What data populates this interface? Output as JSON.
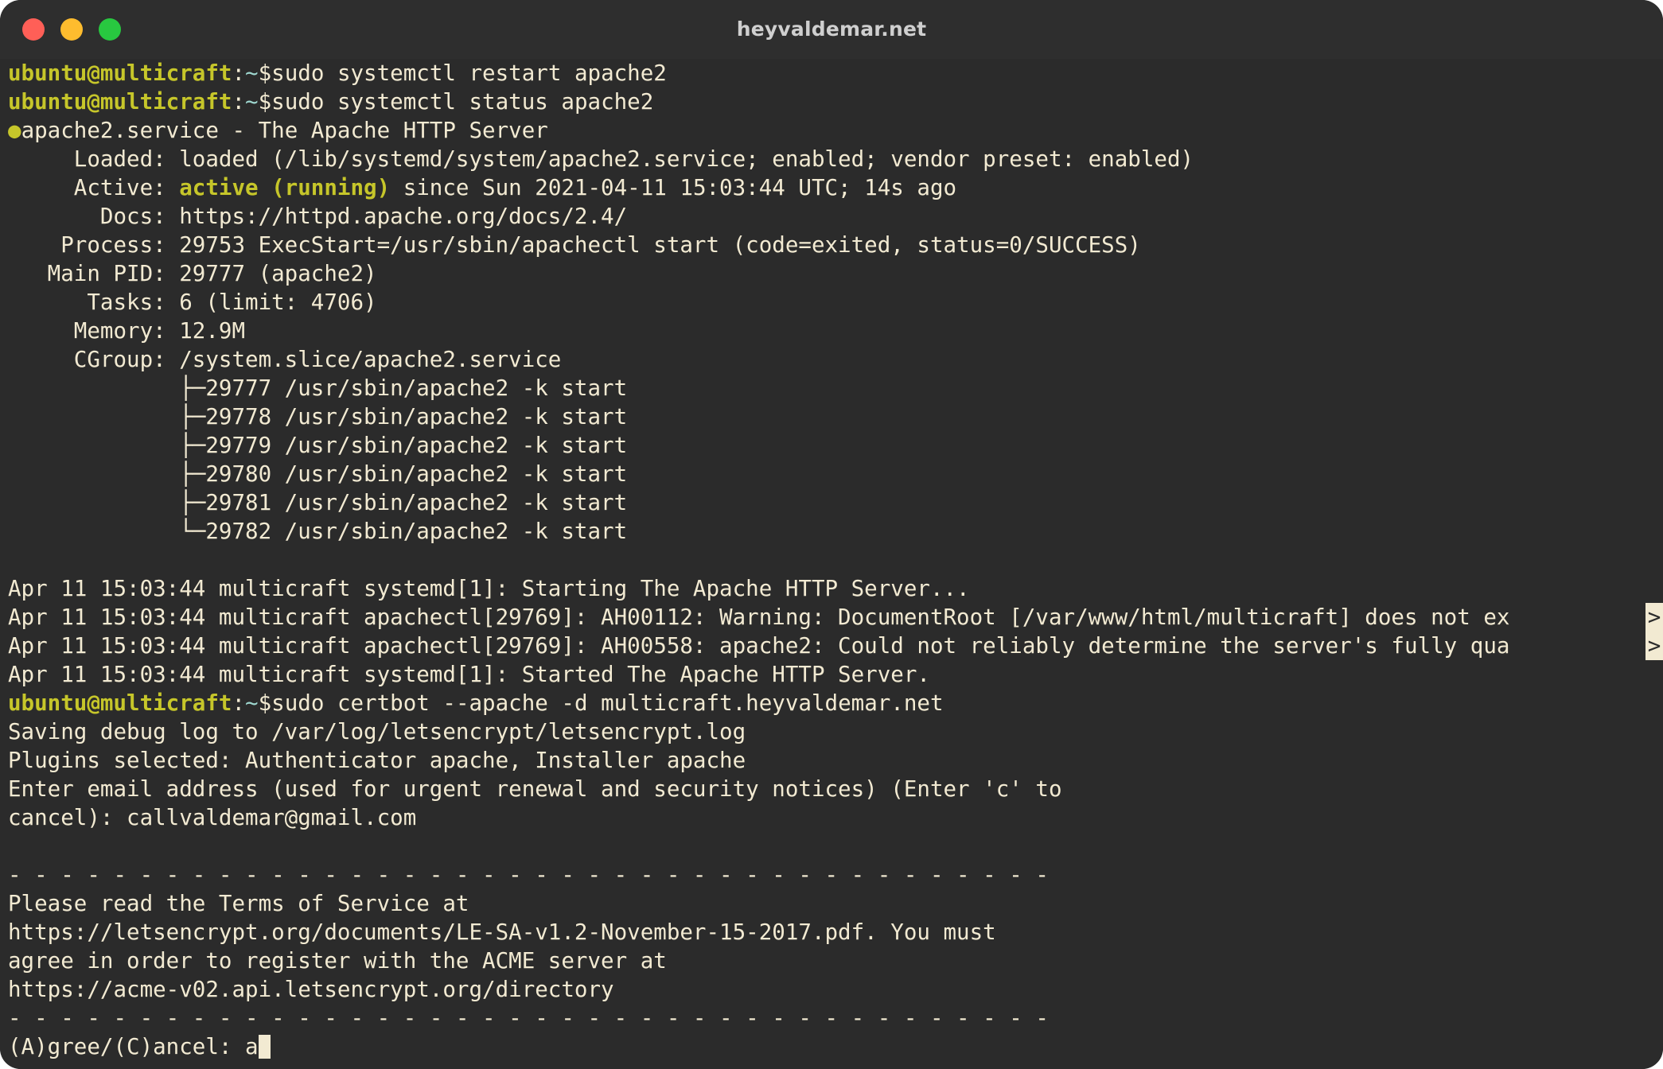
{
  "window": {
    "title": "heyvaldemar.net",
    "controls": [
      {
        "name": "close",
        "color": "#ff5f57"
      },
      {
        "name": "minimize",
        "color": "#febc2e"
      },
      {
        "name": "maximize",
        "color": "#28c840"
      }
    ]
  },
  "theme": {
    "background": "#2b2b2b",
    "titlebar": "#2e2e2e",
    "foreground": "#f2ead2",
    "prompt_user": "#c6c62a",
    "prompt_tilde": "#9fd8d0",
    "status_ok": "#c6c62a",
    "page_background": "#ffffff"
  },
  "prompt": {
    "user_host": "ubuntu@multicraft",
    "colon": ":",
    "path": "~",
    "sigil": "$"
  },
  "commands": {
    "restart": "sudo systemctl restart apache2",
    "status": "sudo systemctl status apache2",
    "certbot": "sudo certbot --apache -d multicraft.heyvaldemar.net"
  },
  "service": {
    "bullet": "●",
    "header": "apache2.service - The Apache HTTP Server",
    "loaded_key": "     Loaded: ",
    "loaded_value": "loaded (/lib/systemd/system/apache2.service; enabled; vendor preset: enabled)",
    "active_key": "     Active: ",
    "active_state": "active (running)",
    "active_rest": " since Sun 2021-04-11 15:03:44 UTC; 14s ago",
    "docs": "       Docs: https://httpd.apache.org/docs/2.4/",
    "process": "    Process: 29753 ExecStart=/usr/sbin/apachectl start (code=exited, status=0/SUCCESS)",
    "main_pid": "   Main PID: 29777 (apache2)",
    "tasks": "      Tasks: 6 (limit: 4706)",
    "memory": "     Memory: 12.9M",
    "cgroup": "     CGroup: /system.slice/apache2.service",
    "children": [
      "             ├─29777 /usr/sbin/apache2 -k start",
      "             ├─29778 /usr/sbin/apache2 -k start",
      "             ├─29779 /usr/sbin/apache2 -k start",
      "             ├─29780 /usr/sbin/apache2 -k start",
      "             ├─29781 /usr/sbin/apache2 -k start",
      "             └─29782 /usr/sbin/apache2 -k start"
    ]
  },
  "journal": [
    {
      "text": "Apr 11 15:03:44 multicraft systemd[1]: Starting The Apache HTTP Server...",
      "truncated": false
    },
    {
      "text": "Apr 11 15:03:44 multicraft apachectl[29769]: AH00112: Warning: DocumentRoot [/var/www/html/multicraft] does not ex",
      "truncated": true,
      "marker": ">"
    },
    {
      "text": "Apr 11 15:03:44 multicraft apachectl[29769]: AH00558: apache2: Could not reliably determine the server's fully qua",
      "truncated": true,
      "marker": ">"
    },
    {
      "text": "Apr 11 15:03:44 multicraft systemd[1]: Started The Apache HTTP Server.",
      "truncated": false
    }
  ],
  "certbot": {
    "saving_log": "Saving debug log to /var/log/letsencrypt/letsencrypt.log",
    "plugins": "Plugins selected: Authenticator apache, Installer apache",
    "email_prompt_line1": "Enter email address (used for urgent renewal and security notices) (Enter 'c' to",
    "email_prompt_line2": "cancel): callvaldemar@gmail.com",
    "separator": "- - - - - - - - - - - - - - - - - - - - - - - - - - - - - - - - - - - - - - - -",
    "tos_line1": "Please read the Terms of Service at",
    "tos_line2": "https://letsencrypt.org/documents/LE-SA-v1.2-November-15-2017.pdf. You must",
    "tos_line3": "agree in order to register with the ACME server at",
    "tos_line4": "https://acme-v02.api.letsencrypt.org/directory",
    "agree_prompt": "(A)gree/(C)ancel: ",
    "agree_input": "a"
  }
}
